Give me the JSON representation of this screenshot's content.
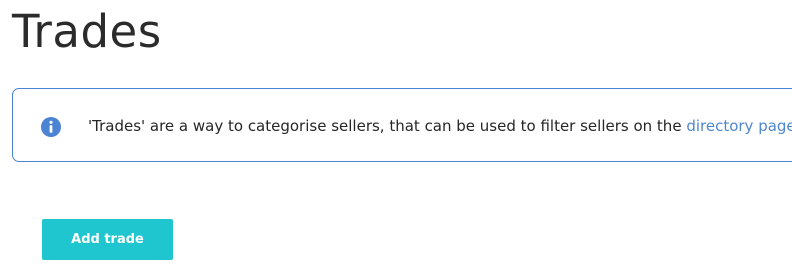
{
  "page": {
    "title": "Trades"
  },
  "info_box": {
    "icon": "info-circle-icon",
    "text_before_link": "'Trades' are a way to categorise sellers, that can be used to filter sellers on the ",
    "link_text": "directory page.",
    "accent_color": "#4a84d2"
  },
  "actions": {
    "add_button_label": "Add trade",
    "button_color": "#20c6cf"
  }
}
